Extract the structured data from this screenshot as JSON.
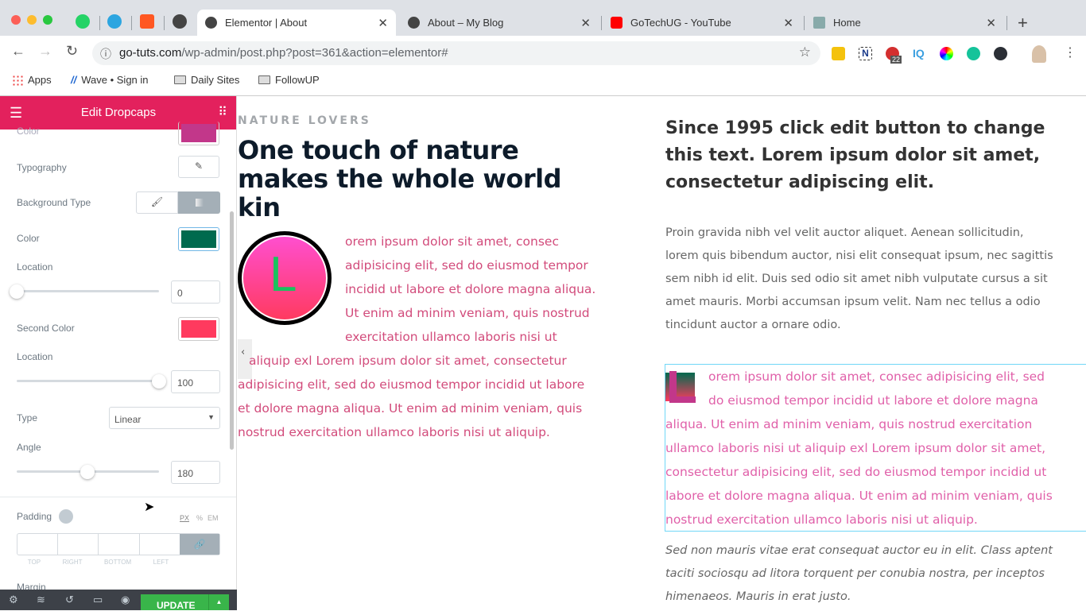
{
  "browser": {
    "pinned_tabs": [
      "whatsapp-icon",
      "telegram-icon",
      "app-icon",
      "globe-icon"
    ],
    "tabs": [
      {
        "title": "Elementor | About",
        "active": true
      },
      {
        "title": "About – My Blog",
        "active": false
      },
      {
        "title": "GoTechUG - YouTube",
        "active": false
      },
      {
        "title": "Home",
        "active": false
      }
    ],
    "url_host": "go-tuts.com",
    "url_path": "/wp-admin/post.php?post=361&action=elementor#",
    "ext_badge": "22",
    "bookmarks": [
      "Apps",
      "Wave • Sign in",
      "Daily Sites",
      "FollowUP"
    ]
  },
  "panel": {
    "title": "Edit Dropcaps",
    "color_label": "Color",
    "color_top": "#c2378a",
    "typography_label": "Typography",
    "bg_type_label": "Background Type",
    "color1_label": "Color",
    "color1": "#006a4e",
    "location1_label": "Location",
    "location1": "0",
    "color2_label": "Second Color",
    "color2": "#ff3a5e",
    "location2_label": "Location",
    "location2": "100",
    "type_label": "Type",
    "type_value": "Linear",
    "angle_label": "Angle",
    "angle": "180",
    "padding_label": "Padding",
    "units": [
      "PX",
      "%",
      "EM"
    ],
    "sides": [
      "TOP",
      "RIGHT",
      "BOTTOM",
      "LEFT"
    ],
    "margin_label": "Margin",
    "update_label": "UPDATE"
  },
  "preview": {
    "eyebrow": "NATURE LOVERS",
    "heading": [
      "One touch of nature",
      "makes the whole world",
      "kin"
    ],
    "dropcap_letter": "L",
    "left_para": [
      "orem ipsum dolor sit amet, consec",
      "adipisicing elit, sed do eiusmod tempor",
      "incidid ut labore et dolore magna aliqua.",
      "Ut enim ad minim veniam, quis nostrud",
      "exercitation ullamco laboris nisi ut",
      "aliquip exl Lorem ipsum dolor sit amet, consectetur",
      "adipisicing elit, sed do eiusmod tempor incidid ut labore",
      "et dolore magna aliqua. Ut enim ad minim veniam, quis",
      "nostrud exercitation ullamco laboris nisi ut aliquip."
    ],
    "right_heading": [
      "Since 1995 click edit button to change",
      "this text. Lorem ipsum dolor sit amet,",
      "consectetur adipiscing elit."
    ],
    "right_para": [
      "Proin gravida nibh vel velit auctor aliquet. Aenean sollicitudin,",
      "lorem quis bibendum auctor, nisi elit consequat ipsum, nec sagittis",
      "sem nibh id elit. Duis sed odio sit amet nibh vulputate cursus a sit",
      "amet mauris. Morbi accumsan ipsum velit. Nam nec tellus a odio",
      "tincidunt auctor a ornare odio."
    ],
    "right_dropcap_para": [
      "orem ipsum dolor sit amet, consec adipisicing elit, sed",
      "do eiusmod tempor incidid ut labore et dolore magna",
      "aliqua. Ut enim ad minim veniam, quis nostrud exercitation",
      "ullamco laboris nisi ut aliquip exl Lorem ipsum dolor sit amet,",
      "consectetur adipisicing elit, sed do eiusmod tempor incidid ut",
      "labore et dolore magna aliqua. Ut enim ad minim veniam, quis",
      "nostrud exercitation ullamco laboris nisi ut aliquip."
    ],
    "italic_para": [
      "Sed non mauris vitae erat consequat auctor eu in elit. Class aptent",
      "taciti sociosqu ad litora torquent per conubia nostra, per inceptos",
      "himenaeos. Mauris in erat justo."
    ]
  }
}
